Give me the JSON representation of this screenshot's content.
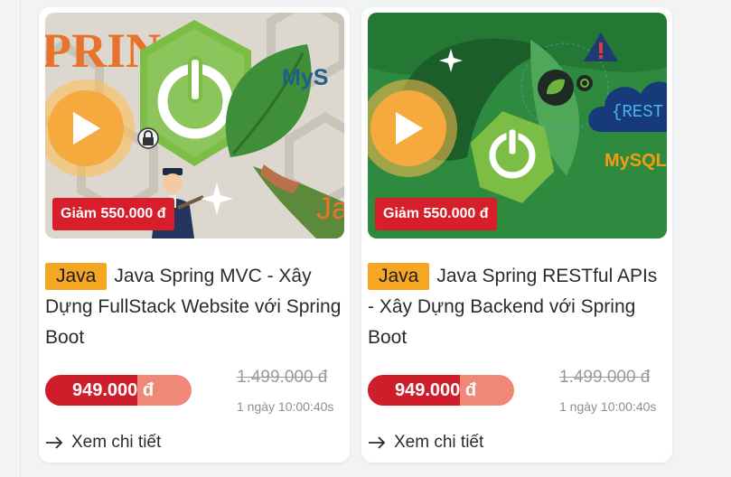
{
  "courses": [
    {
      "thumb_brand": "PRING",
      "thumb_db": "MyS",
      "thumb_lang": "Jav",
      "discount": "Giảm 550.000 đ",
      "tag": "Java",
      "title": "Java Spring MVC - Xây Dựng FullStack Website với Spring Boot",
      "price": "949.000 đ",
      "old_price": "1.499.000 đ",
      "timer": "1 ngày 10:00:40s",
      "detail_label": "Xem chi tiết"
    },
    {
      "thumb_api": "{REST A",
      "thumb_db": "MySQL",
      "discount": "Giảm 550.000 đ",
      "tag": "Java",
      "title": "Java Spring RESTful APIs - Xây Dựng Backend với Spring Boot",
      "price": "949.000 đ",
      "old_price": "1.499.000 đ",
      "timer": "1 ngày 10:00:40s",
      "detail_label": "Xem chi tiết"
    }
  ],
  "colors": {
    "tag": "#f5a623",
    "discount": "#d81e2b",
    "price_dark": "#cf1e2b",
    "price_light": "#f08877",
    "play": "#f6aa3e",
    "spring_green": "#6db33f"
  },
  "icons": [
    "play-icon",
    "arrow-right-icon",
    "power-icon",
    "leaf-icon",
    "warning-icon",
    "lock-icon",
    "cloud-icon"
  ]
}
